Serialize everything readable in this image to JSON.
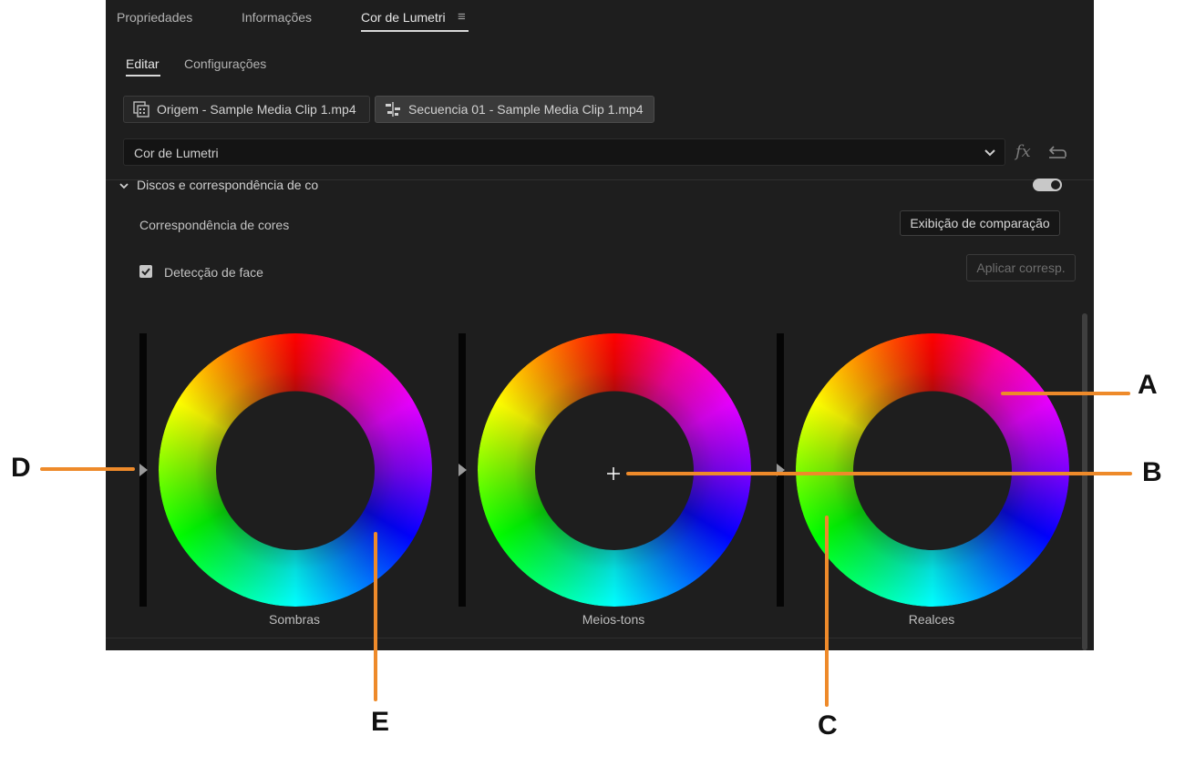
{
  "tabs": [
    {
      "label": "Propriedades"
    },
    {
      "label": "Informações"
    },
    {
      "label": "Cor de Lumetri",
      "active": true
    }
  ],
  "subtabs": [
    {
      "label": "Editar",
      "active": true
    },
    {
      "label": "Configurações"
    }
  ],
  "clips": {
    "source": "Origem - Sample Media Clip 1.mp4",
    "sequence": "Secuencia 01 - Sample Media Clip 1.mp4"
  },
  "effect_select": {
    "value": "Cor de Lumetri"
  },
  "fx_label": "fx",
  "section": {
    "title": "Discos e correspondência de co",
    "toggle_on": true,
    "color_match_label": "Correspondência de cores",
    "compare_button": "Exibição de comparação",
    "face_detect_label": "Detecção de face",
    "face_detect_checked": true,
    "apply_button": "Aplicar corresp."
  },
  "wheels": [
    {
      "label": "Sombras"
    },
    {
      "label": "Meios-tons"
    },
    {
      "label": "Realces"
    }
  ],
  "callouts": [
    "A",
    "B",
    "C",
    "D",
    "E"
  ],
  "colors": {
    "panel": "#1e1e1e",
    "callout": "#ee8a2a"
  }
}
